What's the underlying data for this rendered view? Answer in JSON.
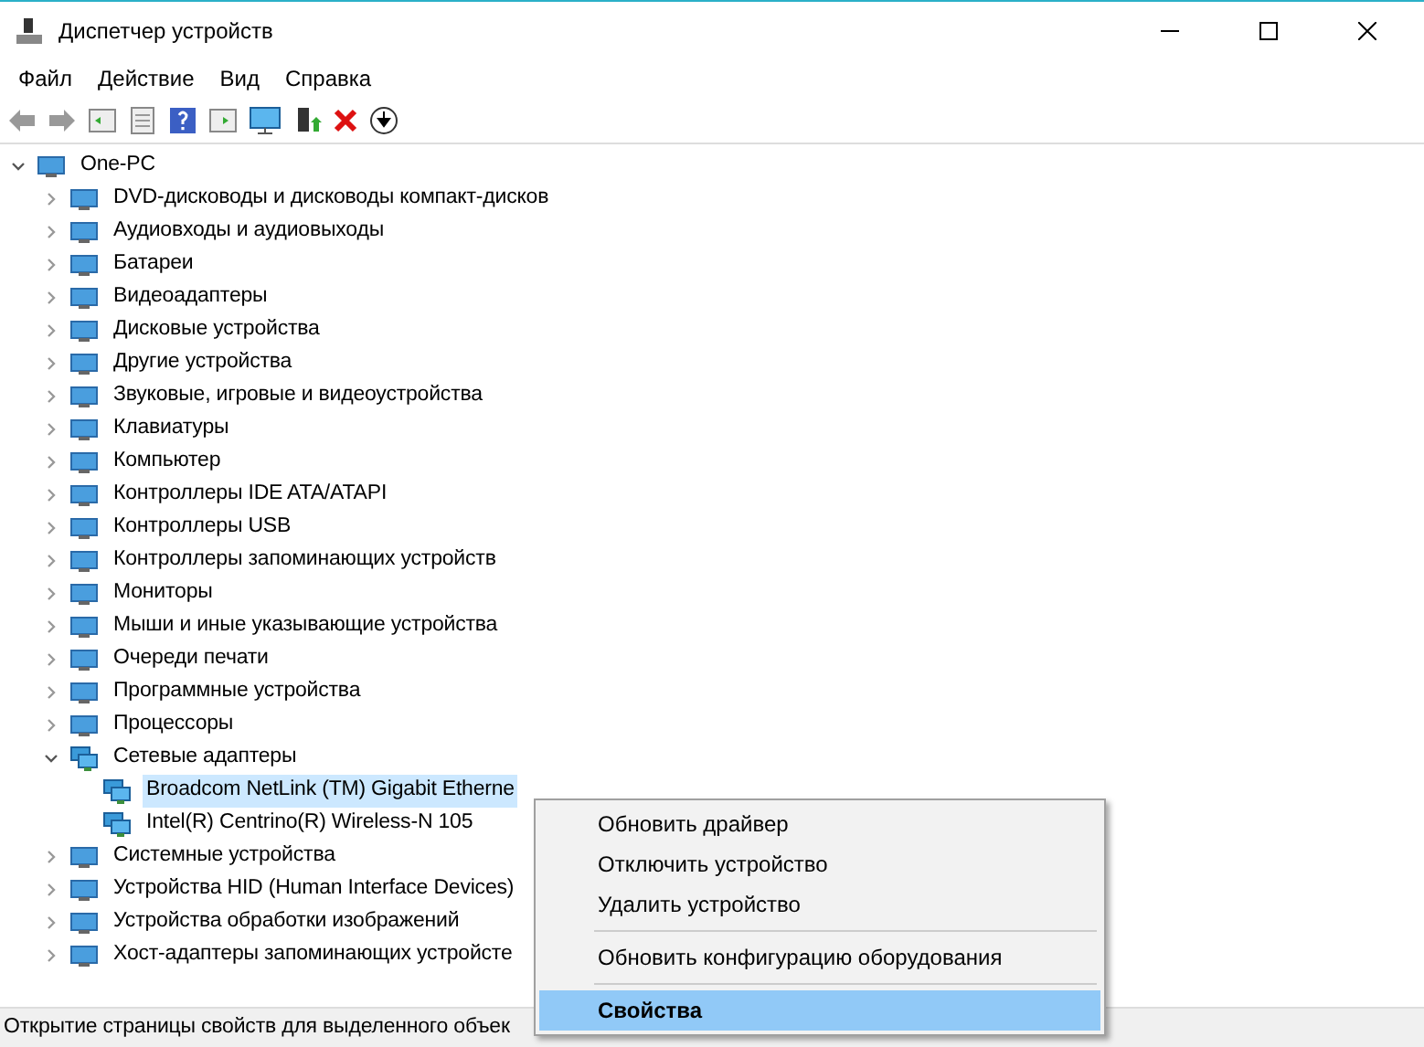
{
  "window": {
    "title": "Диспетчер устройств"
  },
  "menu_bar": [
    "Файл",
    "Действие",
    "Вид",
    "Справка"
  ],
  "tree": {
    "label": "One-PC",
    "expanded": true,
    "children": [
      {
        "label": "DVD-дисководы и дисководы компакт-дисков",
        "expanded": false,
        "selected": false
      },
      {
        "label": "Аудиовходы и аудиовыходы",
        "expanded": false,
        "selected": false
      },
      {
        "label": "Батареи",
        "expanded": false,
        "selected": false
      },
      {
        "label": "Видеоадаптеры",
        "expanded": false,
        "selected": false
      },
      {
        "label": "Дисковые устройства",
        "expanded": false,
        "selected": false
      },
      {
        "label": "Другие устройства",
        "expanded": false,
        "selected": false
      },
      {
        "label": "Звуковые, игровые и видеоустройства",
        "expanded": false,
        "selected": false
      },
      {
        "label": "Клавиатуры",
        "expanded": false,
        "selected": false
      },
      {
        "label": "Компьютер",
        "expanded": false,
        "selected": false
      },
      {
        "label": "Контроллеры IDE ATA/ATAPI",
        "expanded": false,
        "selected": false
      },
      {
        "label": "Контроллеры USB",
        "expanded": false,
        "selected": false
      },
      {
        "label": "Контроллеры запоминающих устройств",
        "expanded": false,
        "selected": false
      },
      {
        "label": "Мониторы",
        "expanded": false,
        "selected": false
      },
      {
        "label": "Мыши и иные указывающие устройства",
        "expanded": false,
        "selected": false
      },
      {
        "label": "Очереди печати",
        "expanded": false,
        "selected": false
      },
      {
        "label": "Программные устройства",
        "expanded": false,
        "selected": false
      },
      {
        "label": "Процессоры",
        "expanded": false,
        "selected": false
      },
      {
        "label": "Сетевые адаптеры",
        "expanded": true,
        "selected": false,
        "children": [
          {
            "label": "Broadcom NetLink (TM) Gigabit Etherne",
            "selected": true
          },
          {
            "label": "Intel(R) Centrino(R) Wireless-N 105",
            "selected": false
          }
        ]
      },
      {
        "label": "Системные устройства",
        "expanded": false,
        "selected": false
      },
      {
        "label": "Устройства HID (Human Interface Devices)",
        "expanded": false,
        "selected": false
      },
      {
        "label": "Устройства обработки изображений",
        "expanded": false,
        "selected": false
      },
      {
        "label": "Хост-адаптеры запоминающих устройсте",
        "expanded": false,
        "selected": false
      }
    ]
  },
  "context_menu": [
    {
      "kind": "item",
      "label": "Обновить драйвер",
      "selected": false,
      "default": false
    },
    {
      "kind": "item",
      "label": "Отключить устройство",
      "selected": false,
      "default": false
    },
    {
      "kind": "item",
      "label": "Удалить устройство",
      "selected": false,
      "default": false
    },
    {
      "kind": "separator"
    },
    {
      "kind": "item",
      "label": "Обновить конфигурацию оборудования",
      "selected": false,
      "default": false
    },
    {
      "kind": "separator"
    },
    {
      "kind": "item",
      "label": "Свойства",
      "selected": true,
      "default": true
    }
  ],
  "status_bar": "Открытие страницы свойств для выделенного объек"
}
